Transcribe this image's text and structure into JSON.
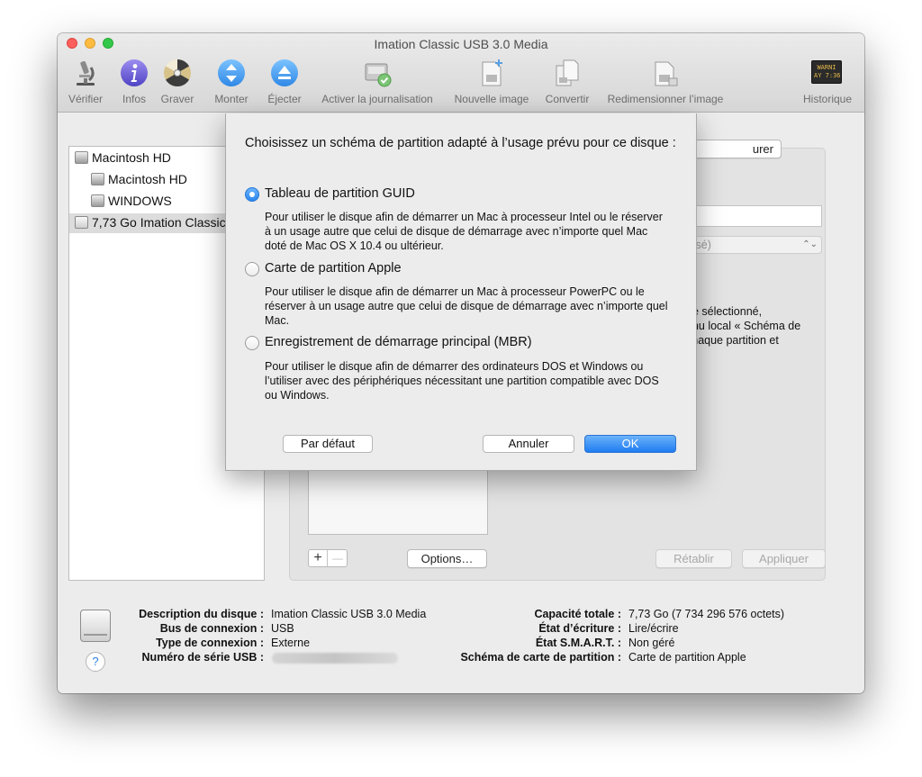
{
  "window": {
    "title": "Imation Classic USB 3.0 Media"
  },
  "toolbar": {
    "items": [
      {
        "label": "Vérifier",
        "icon": "microscope-icon"
      },
      {
        "label": "Infos",
        "icon": "info-icon"
      },
      {
        "label": "Graver",
        "icon": "burn-icon"
      },
      {
        "label": "Monter",
        "icon": "mount-icon"
      },
      {
        "label": "Éjecter",
        "icon": "eject-icon"
      },
      {
        "label": "Activer la journalisation",
        "icon": "journaling-icon"
      },
      {
        "label": "Nouvelle image",
        "icon": "new-image-icon"
      },
      {
        "label": "Convertir",
        "icon": "convert-icon"
      },
      {
        "label": "Redimensionner l’image",
        "icon": "resize-image-icon"
      },
      {
        "label": "Historique",
        "icon": "log-icon",
        "icon_text": "WARNI\nAY 7:36"
      }
    ]
  },
  "sidebar": {
    "items": [
      {
        "label": "Macintosh HD",
        "level": 0
      },
      {
        "label": "Macintosh HD",
        "level": 1
      },
      {
        "label": "WINDOWS",
        "level": 1
      },
      {
        "label": "7,73 Go Imation Classic USB 3.0 Media",
        "level": 0,
        "selected": true
      }
    ]
  },
  "panel": {
    "partial_button": "urer",
    "partial_select": "lisé)",
    "partial_text": [
      "ue sélectionné,",
      "enu local « Schéma de",
      "chaque partition et"
    ],
    "add_label": "+",
    "remove_label": "—",
    "options_label": "Options…",
    "restore_label": "Rétablir",
    "apply_label": "Appliquer"
  },
  "dialog": {
    "prompt": "Choisissez un schéma de partition adapté à l’usage prévu pour ce disque :",
    "options": [
      {
        "label": "Tableau de partition GUID",
        "description": "Pour utiliser le disque afin de démarrer un Mac à processeur Intel ou le réserver à un usage autre que celui de disque de démarrage avec n’importe quel Mac doté de Mac OS X 10.4 ou ultérieur.",
        "selected": true
      },
      {
        "label": "Carte de partition Apple",
        "description": "Pour utiliser le disque afin de démarrer un Mac à processeur PowerPC ou le réserver à un usage autre que celui de disque de démarrage avec n’importe quel Mac.",
        "selected": false
      },
      {
        "label": "Enregistrement de démarrage principal (MBR)",
        "description": "Pour utiliser le disque afin de démarrer des ordinateurs DOS et Windows ou l’utiliser avec des périphériques nécessitant une partition compatible avec DOS ou Windows.",
        "selected": false
      }
    ],
    "default_label": "Par défaut",
    "cancel_label": "Annuler",
    "ok_label": "OK"
  },
  "disk_info": {
    "left": [
      {
        "key": "Description du disque :",
        "value": "Imation Classic USB 3.0 Media"
      },
      {
        "key": "Bus de connexion :",
        "value": "USB"
      },
      {
        "key": "Type de connexion :",
        "value": "Externe"
      },
      {
        "key": "Numéro de série USB :",
        "value": ""
      }
    ],
    "right": [
      {
        "key": "Capacité totale :",
        "value": "7,73 Go (7 734 296 576 octets)"
      },
      {
        "key": "État d’écriture :",
        "value": "Lire/écrire"
      },
      {
        "key": "État S.M.A.R.T. :",
        "value": "Non géré"
      },
      {
        "key": "Schéma de carte de partition :",
        "value": "Carte de partition Apple"
      }
    ],
    "help_label": "?"
  },
  "colors": {
    "accent": "#2a86ee",
    "close": "#fc605c",
    "minimize": "#fdbc40",
    "maximize": "#34c84a"
  }
}
